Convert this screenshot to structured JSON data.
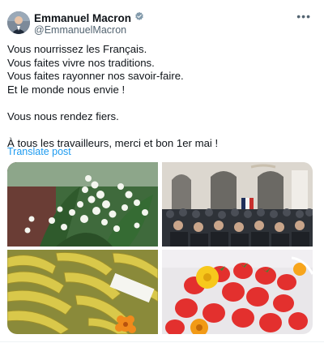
{
  "author": {
    "name": "Emmanuel Macron",
    "handle": "@EmmanuelMacron",
    "verified_color": "#829aab"
  },
  "tweet": {
    "lines_block1": "Vous nourrissez les Français.\nVous faites vivre nos traditions.\nVous faites rayonner nos savoir-faire.\nEt le monde nous envie !",
    "line2": "Vous nous rendez fiers.",
    "line3": "À tous les travailleurs, merci et bon 1er mai !",
    "translate_label": "Translate post"
  },
  "media": {
    "images": [
      "lily-of-the-valley",
      "ceremony-audience",
      "bananas",
      "strawberries-and-marigolds"
    ]
  },
  "colors": {
    "link": "#1d9bf0",
    "secondary": "#536471"
  }
}
